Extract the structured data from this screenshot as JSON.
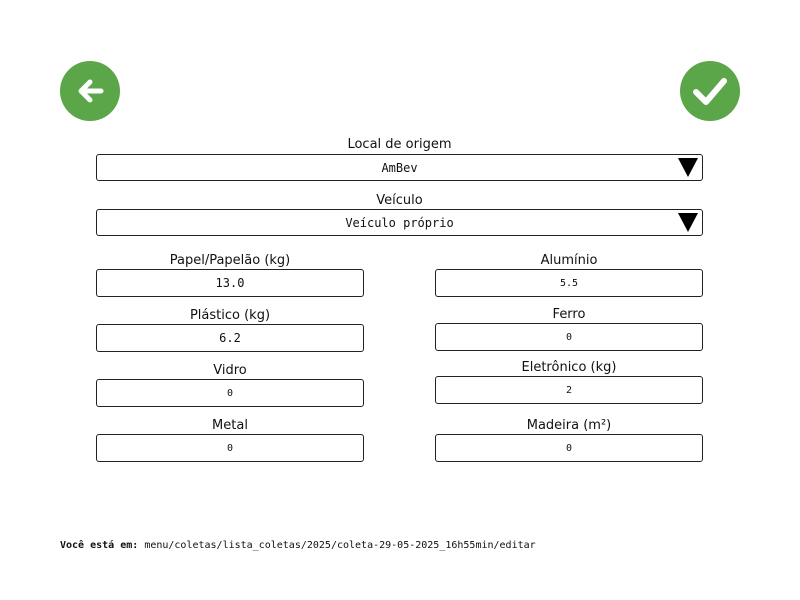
{
  "header": {
    "back_icon": "arrow-left-icon",
    "confirm_icon": "check-icon",
    "accent_color": "#5aa648"
  },
  "form": {
    "origin": {
      "label": "Local de origem",
      "value": "AmBev",
      "icon": "triangle-down-icon"
    },
    "vehicle": {
      "label": "Veículo",
      "value": "Veículo próprio",
      "icon": "triangle-down-icon"
    },
    "paper": {
      "label": "Papel/Papelão (kg)",
      "value": "13.0"
    },
    "aluminum": {
      "label": "Alumínio",
      "value": "5.5"
    },
    "plastic": {
      "label": "Plástico (kg)",
      "value": "6.2"
    },
    "iron": {
      "label": "Ferro",
      "value": "0"
    },
    "glass": {
      "label": "Vidro",
      "value": "0"
    },
    "electronic": {
      "label": "Eletrônico (kg)",
      "value": "2"
    },
    "metal": {
      "label": "Metal",
      "value": "0"
    },
    "wood": {
      "label": "Madeira (m²)",
      "value": "0"
    }
  },
  "breadcrumb": {
    "label": "Você está em:",
    "path": "menu/coletas/lista_coletas/2025/coleta-29-05-2025_16h55min/editar"
  }
}
